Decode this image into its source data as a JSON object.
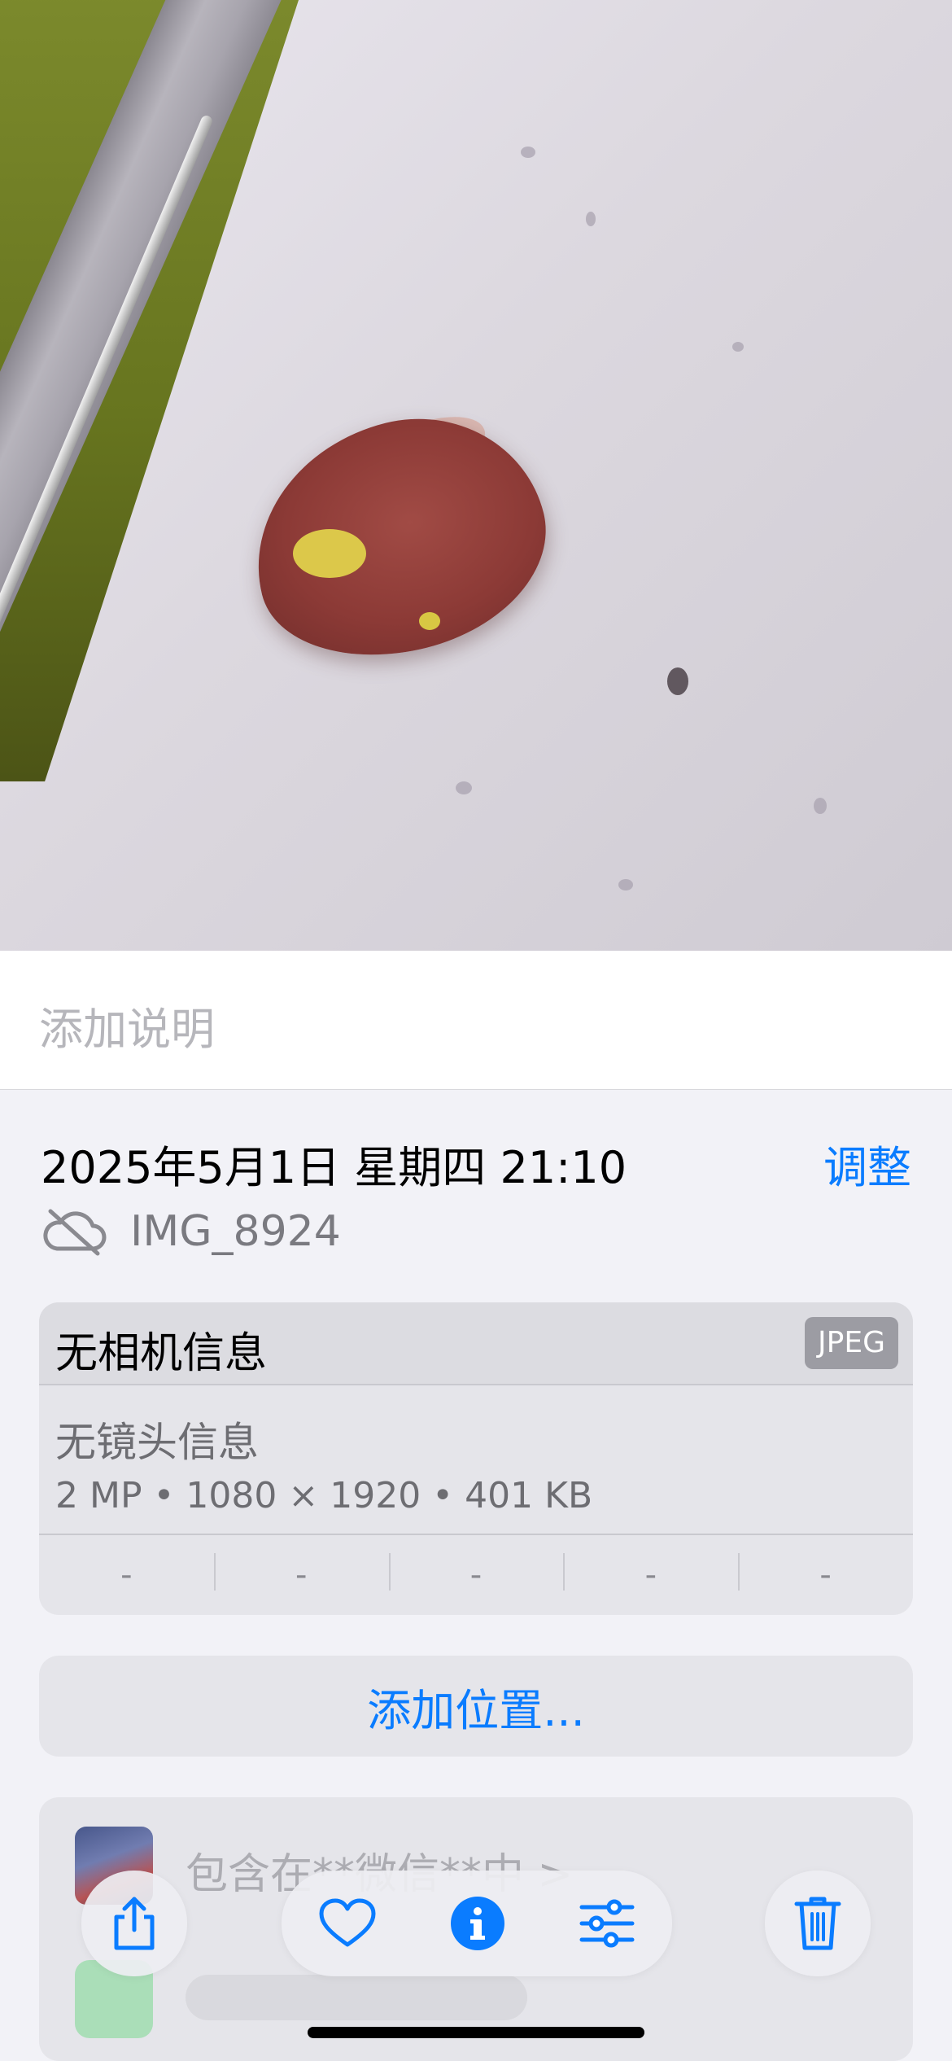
{
  "caption": {
    "placeholder": "添加说明"
  },
  "info": {
    "datetime": "2025年5月1日 星期四 21:10",
    "adjust_label": "调整",
    "filename": "IMG_8924"
  },
  "metadata": {
    "camera": "无相机信息",
    "format_badge": "JPEG",
    "lens": "无镜头信息",
    "specs": "2 MP • 1080 × 1920 • 401 KB",
    "exif_values": [
      "-",
      "-",
      "-",
      "-",
      "-"
    ]
  },
  "location": {
    "label": "添加位置..."
  },
  "album": {
    "text": "包含在**微信**中 >"
  },
  "toolbar": {
    "icons": [
      "share-icon",
      "heart-icon",
      "info-icon",
      "adjust-icon",
      "trash-icon"
    ],
    "accent": "#0a7cff"
  },
  "colors": {
    "accent": "#0a7cff",
    "background": "#f2f2f7"
  }
}
